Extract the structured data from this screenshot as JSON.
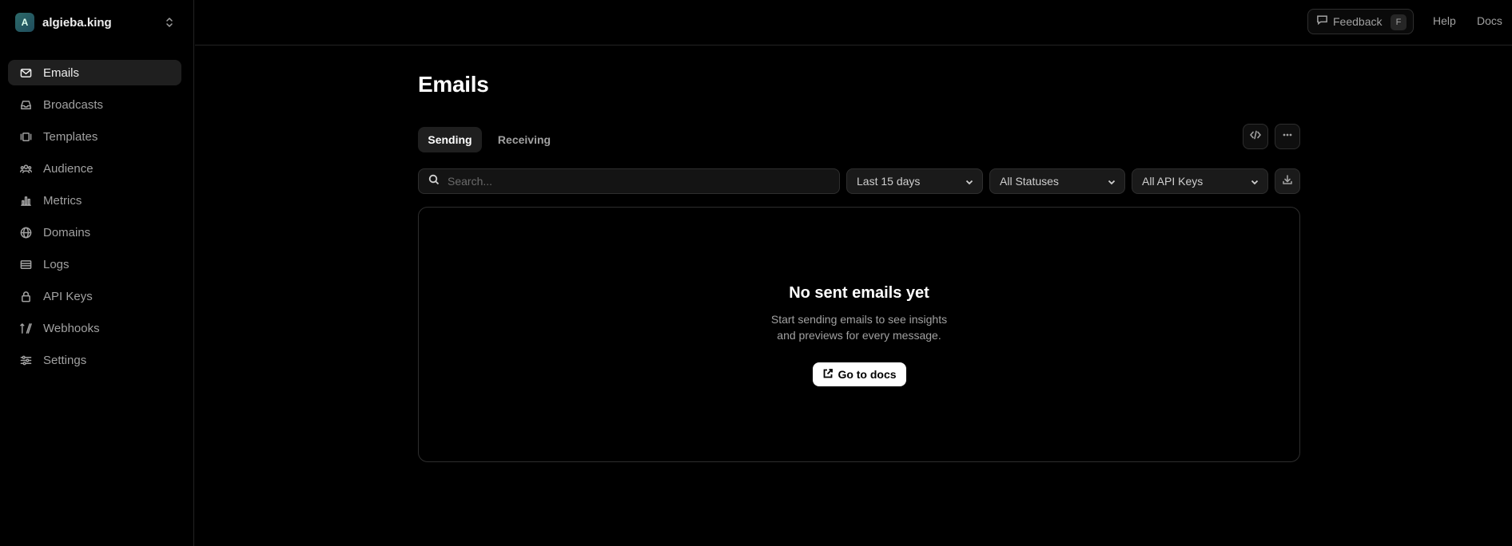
{
  "team": {
    "initial": "A",
    "name": "algieba.king"
  },
  "nav": {
    "items": [
      {
        "label": "Emails",
        "icon": "mail-icon",
        "active": true
      },
      {
        "label": "Broadcasts",
        "icon": "inbox-icon",
        "active": false
      },
      {
        "label": "Templates",
        "icon": "templates-icon",
        "active": false
      },
      {
        "label": "Audience",
        "icon": "users-icon",
        "active": false
      },
      {
        "label": "Metrics",
        "icon": "bar-chart-icon",
        "active": false
      },
      {
        "label": "Domains",
        "icon": "globe-icon",
        "active": false
      },
      {
        "label": "Logs",
        "icon": "logs-icon",
        "active": false
      },
      {
        "label": "API Keys",
        "icon": "lock-icon",
        "active": false
      },
      {
        "label": "Webhooks",
        "icon": "webhook-icon",
        "active": false
      },
      {
        "label": "Settings",
        "icon": "sliders-icon",
        "active": false
      }
    ]
  },
  "topbar": {
    "feedback_label": "Feedback",
    "feedback_shortcut": "F",
    "help_label": "Help",
    "docs_label": "Docs"
  },
  "page": {
    "title": "Emails",
    "tabs": [
      {
        "label": "Sending",
        "active": true
      },
      {
        "label": "Receiving",
        "active": false
      }
    ]
  },
  "filters": {
    "search_placeholder": "Search...",
    "date_range": "Last 15 days",
    "status": "All Statuses",
    "api_keys": "All API Keys"
  },
  "empty_state": {
    "title": "No sent emails yet",
    "description_line1": "Start sending emails to see insights",
    "description_line2": "and previews for every message.",
    "button_label": "Go to docs"
  }
}
